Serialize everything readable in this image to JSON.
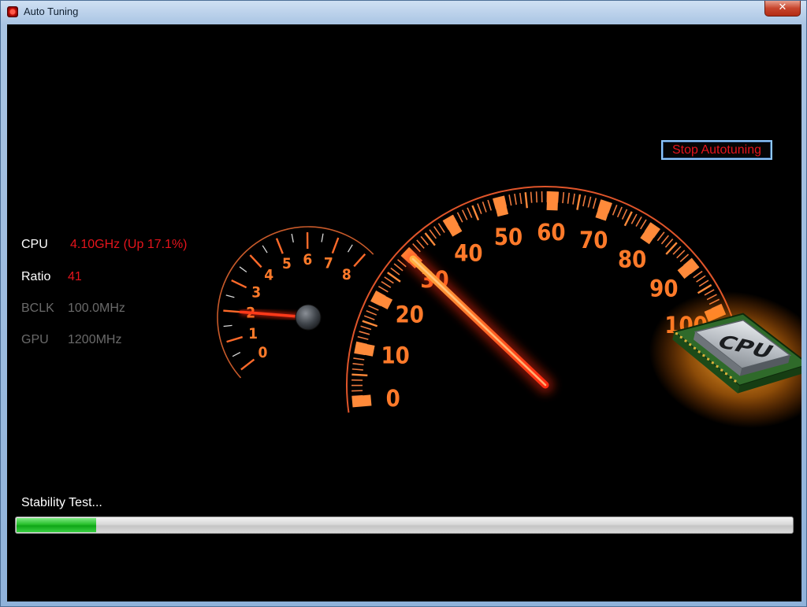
{
  "window": {
    "title": "Auto Tuning",
    "close_label": "✕"
  },
  "stop_button": {
    "label": "Stop Autotuning"
  },
  "stats": [
    {
      "label": "CPU",
      "value": "4.10GHz (Up 17.1%)",
      "label_color": "#ffffff",
      "value_color": "#e5141c"
    },
    {
      "label": "Ratio",
      "value": "41",
      "label_color": "#ffffff",
      "value_color": "#e5141c"
    },
    {
      "label": "BCLK",
      "value": "100.0MHz",
      "label_color": "#6a6a6a",
      "value_color": "#6a6a6a"
    },
    {
      "label": "GPU",
      "value": "1200MHz",
      "label_color": "#6a6a6a",
      "value_color": "#6a6a6a"
    }
  ],
  "small_gauge": {
    "tick_labels": [
      "0",
      "1",
      "2",
      "3",
      "4",
      "5",
      "6",
      "7",
      "8"
    ],
    "needle_value": 2
  },
  "main_gauge": {
    "tick_labels": [
      "0",
      "10",
      "20",
      "30",
      "40",
      "50",
      "60",
      "70",
      "80",
      "90",
      "100"
    ],
    "needle_value": 30
  },
  "cpu_chip": {
    "label": "CPU",
    "icon": "cpu-chip-icon"
  },
  "status": {
    "text": "Stability Test..."
  },
  "progress": {
    "fraction": 0.102
  },
  "colors": {
    "accent_orange": "#ff7a2a",
    "needle_red": "#ff2a10",
    "value_red": "#e5141c",
    "progress_green": "#1fb826"
  }
}
